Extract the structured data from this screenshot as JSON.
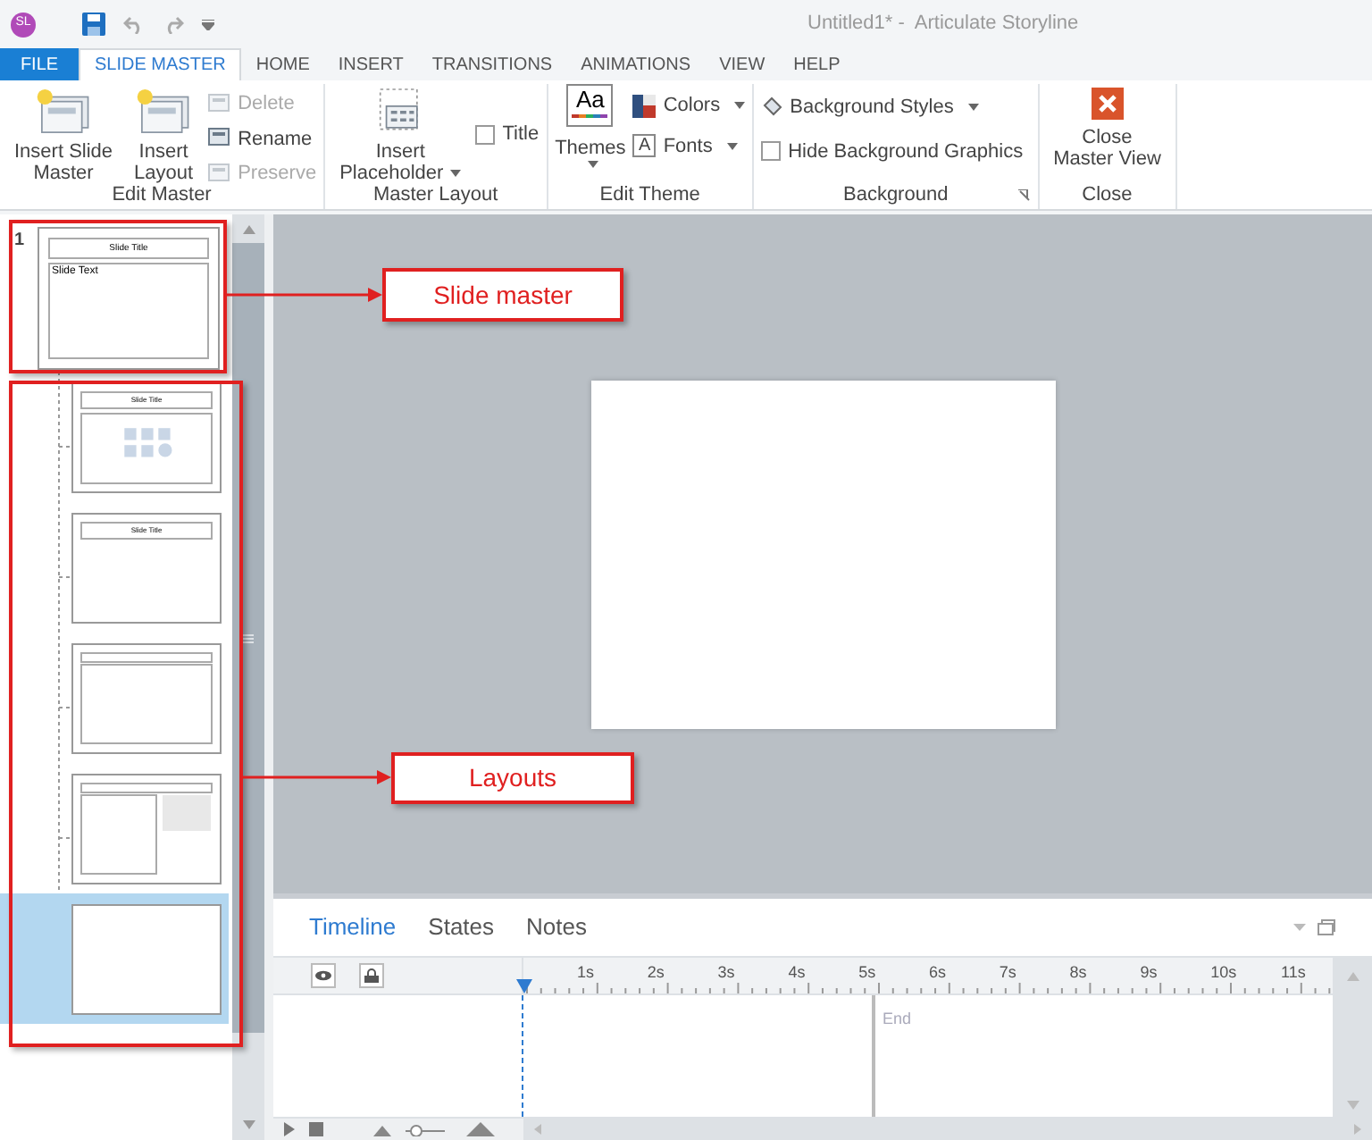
{
  "title_bar": {
    "avatar": "SL",
    "title": "Untitled1* -  Articulate Storyline"
  },
  "tabs": [
    {
      "label": "FILE",
      "kind": "file",
      "selected": false
    },
    {
      "label": "SLIDE MASTER",
      "kind": "tab",
      "selected": true
    },
    {
      "label": "HOME",
      "kind": "tab",
      "selected": false
    },
    {
      "label": "INSERT",
      "kind": "tab",
      "selected": false
    },
    {
      "label": "TRANSITIONS",
      "kind": "tab",
      "selected": false
    },
    {
      "label": "ANIMATIONS",
      "kind": "tab",
      "selected": false
    },
    {
      "label": "VIEW",
      "kind": "tab",
      "selected": false
    },
    {
      "label": "HELP",
      "kind": "tab",
      "selected": false
    }
  ],
  "ribbon": {
    "edit_master": {
      "label": "Edit Master",
      "insert_slide_master": [
        "Insert Slide",
        "Master"
      ],
      "insert_layout": [
        "Insert",
        "Layout"
      ],
      "small": [
        {
          "label": "Delete",
          "disabled": true
        },
        {
          "label": "Rename",
          "disabled": false
        },
        {
          "label": "Preserve",
          "disabled": true
        }
      ]
    },
    "master_layout": {
      "label": "Master Layout",
      "insert_placeholder": [
        "Insert",
        "Placeholder"
      ],
      "title_check": {
        "label": "Title",
        "checked": false
      }
    },
    "edit_theme": {
      "label": "Edit Theme",
      "themes": "Themes",
      "theme_sample": "Aa",
      "colors": "Colors",
      "fonts": "Fonts",
      "fonts_glyph": "A"
    },
    "background": {
      "label": "Background",
      "styles": "Background Styles",
      "hide": {
        "label": "Hide Background Graphics",
        "checked": false
      }
    },
    "close": {
      "label": "Close",
      "button": [
        "Close",
        "Master View"
      ]
    }
  },
  "master_slide": {
    "number": "1",
    "title": "Slide Title",
    "text": "Slide Text"
  },
  "layouts": [
    {
      "kind": "title-content",
      "title": "Slide Title",
      "selected": false
    },
    {
      "kind": "title-only",
      "title": "Slide Title",
      "selected": false
    },
    {
      "kind": "question",
      "selected": false
    },
    {
      "kind": "question-media",
      "selected": false
    },
    {
      "kind": "blank",
      "selected": true
    }
  ],
  "timeline": {
    "tabs": [
      {
        "label": "Timeline",
        "selected": true
      },
      {
        "label": "States",
        "selected": false
      },
      {
        "label": "Notes",
        "selected": false
      }
    ],
    "ticks": [
      "1s",
      "2s",
      "3s",
      "4s",
      "5s",
      "6s",
      "7s",
      "8s",
      "9s",
      "10s",
      "11s"
    ],
    "end_label": "End"
  },
  "annotations": [
    {
      "label": "Slide master"
    },
    {
      "label": "Layouts"
    }
  ]
}
